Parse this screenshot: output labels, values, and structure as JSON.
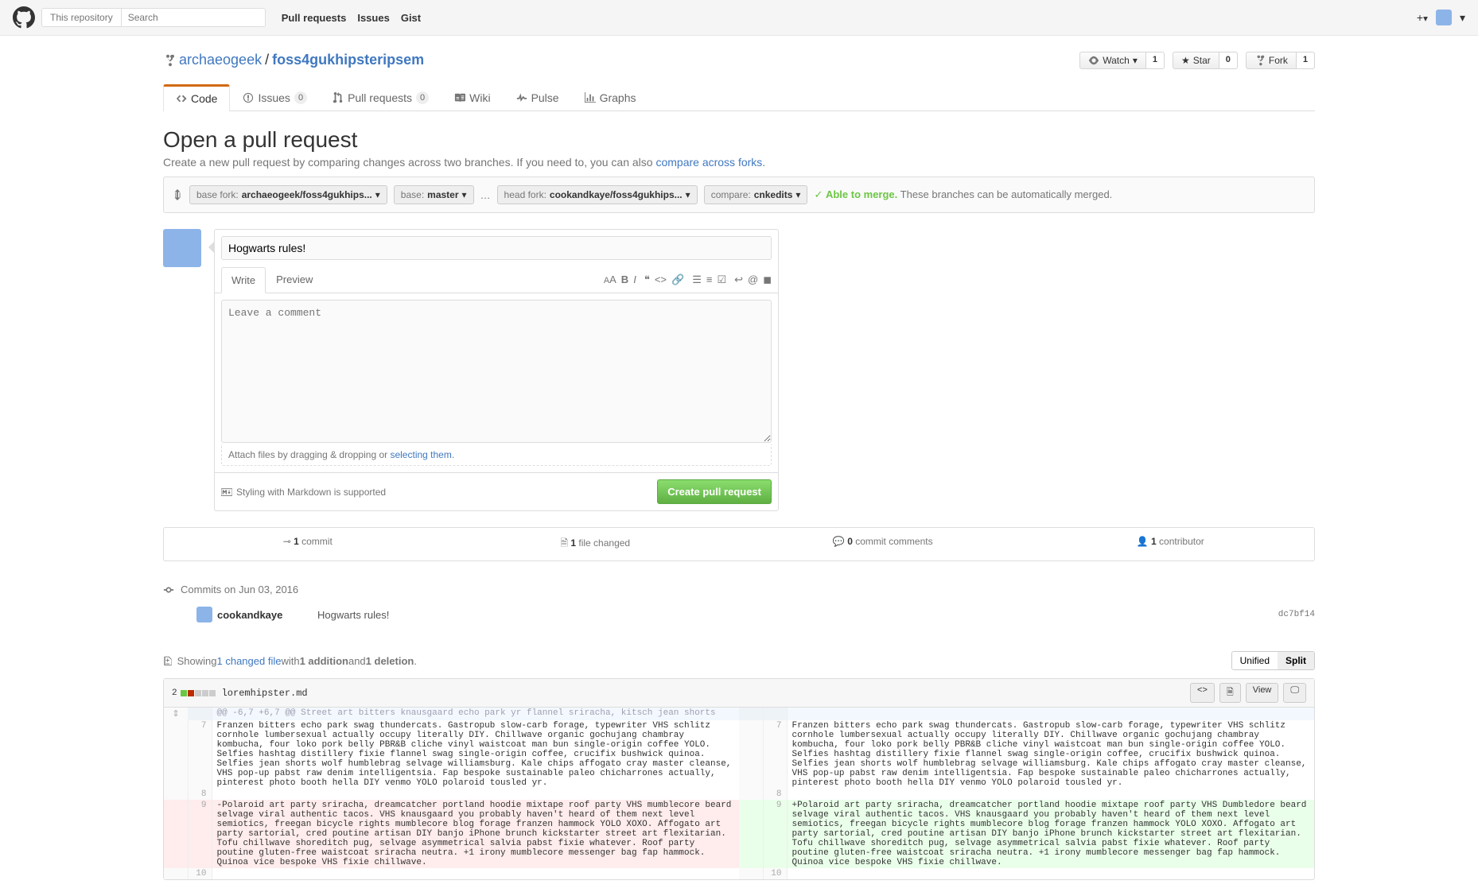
{
  "header": {
    "search_scope": "This repository",
    "search_placeholder": "Search",
    "nav": {
      "pulls": "Pull requests",
      "issues": "Issues",
      "gist": "Gist"
    }
  },
  "repo": {
    "owner": "archaeogeek",
    "name": "foss4gukhipsteripsem",
    "watch": {
      "label": "Watch",
      "count": "1"
    },
    "star": {
      "label": "Star",
      "count": "0"
    },
    "fork": {
      "label": "Fork",
      "count": "1"
    }
  },
  "reponav": {
    "code": "Code",
    "issues": {
      "label": "Issues",
      "count": "0"
    },
    "pulls": {
      "label": "Pull requests",
      "count": "0"
    },
    "wiki": "Wiki",
    "pulse": "Pulse",
    "graphs": "Graphs"
  },
  "pr": {
    "title": "Open a pull request",
    "subtitle_a": "Create a new pull request by comparing changes across two branches. If you need to, you can also ",
    "subtitle_link": "compare across forks",
    "range": {
      "base_fork_label": "base fork:",
      "base_fork_value": "archaeogeek/foss4gukhips...",
      "base_label": "base:",
      "base_value": "master",
      "head_fork_label": "head fork:",
      "head_fork_value": "cookandkaye/foss4gukhips...",
      "compare_label": "compare:",
      "compare_value": "cnkedits",
      "merge_ok": "Able to merge.",
      "merge_desc": " These branches can be automatically merged."
    },
    "form": {
      "title_value": "Hogwarts rules!",
      "write_tab": "Write",
      "preview_tab": "Preview",
      "comment_placeholder": "Leave a comment",
      "drag_hint_a": "Attach files by dragging & dropping or ",
      "drag_hint_link": "selecting them",
      "md_hint": "Styling with Markdown is supported",
      "submit": "Create pull request"
    }
  },
  "stats": {
    "commits": {
      "n": "1",
      "label": " commit"
    },
    "files": {
      "n": "1",
      "label": " file changed"
    },
    "comments": {
      "n": "0",
      "label": " commit comments"
    },
    "contributors": {
      "n": "1",
      "label": " contributor"
    }
  },
  "commits": {
    "date": "Commits on Jun 03, 2016",
    "rows": [
      {
        "author": "cookandkaye",
        "msg": "Hogwarts rules!",
        "sha": "dc7bf14"
      }
    ]
  },
  "diff_summary": {
    "a": "Showing ",
    "files_link": "1 changed file",
    "b": " with ",
    "additions": "1 addition",
    "c": " and ",
    "deletions": "1 deletion",
    "unified": "Unified",
    "split": "Split"
  },
  "file": {
    "changes": "2",
    "name": "loremhipster.md",
    "view": "View",
    "hunk": "@@ -6,7 +6,7 @@ Street art bitters knausgaard echo park yr flannel sriracha, kitsch jean shorts",
    "ctx_line": "Franzen bitters echo park swag thundercats. Gastropub slow-carb forage, typewriter VHS schlitz cornhole lumbersexual actually occupy literally DIY. Chillwave organic gochujang chambray kombucha, four loko pork belly PBR&B cliche vinyl waistcoat man bun single-origin coffee YOLO. Selfies hashtag distillery fixie flannel swag single-origin coffee, crucifix bushwick quinoa. Selfies jean shorts wolf humblebrag selvage williamsburg. Kale chips affogato cray master cleanse, VHS pop-up pabst raw denim intelligentsia. Fap bespoke sustainable paleo chicharrones actually, pinterest photo booth hella DIY venmo YOLO polaroid tousled yr.",
    "del_line": "-Polaroid art party sriracha, dreamcatcher portland hoodie mixtape roof party VHS mumblecore beard selvage viral authentic tacos. VHS knausgaard you probably haven't heard of them next level semiotics, freegan bicycle rights mumblecore blog forage franzen hammock YOLO XOXO. Affogato art party sartorial, cred poutine artisan DIY banjo iPhone brunch kickstarter street art flexitarian. Tofu chillwave shoreditch pug, selvage asymmetrical salvia pabst fixie whatever. Roof party poutine gluten-free waistcoat sriracha neutra. +1 irony mumblecore messenger bag fap hammock. Quinoa vice bespoke VHS fixie chillwave.",
    "add_line": "+Polaroid art party sriracha, dreamcatcher portland hoodie mixtape roof party VHS Dumbledore beard selvage viral authentic tacos. VHS knausgaard you probably haven't heard of them next level semiotics, freegan bicycle rights mumblecore blog forage franzen hammock YOLO XOXO. Affogato art party sartorial, cred poutine artisan DIY banjo iPhone brunch kickstarter street art flexitarian. Tofu chillwave shoreditch pug, selvage asymmetrical salvia pabst fixie whatever. Roof party poutine gluten-free waistcoat sriracha neutra. +1 irony mumblecore messenger bag fap hammock. Quinoa vice bespoke VHS fixie chillwave.",
    "l_ctx_old": "7",
    "l_ctx_new": "7",
    "l_blank_old": "8",
    "l_blank_new": "8",
    "l_del": "9",
    "l_add": "9",
    "l_last_old": "10",
    "l_last_new": "10"
  }
}
